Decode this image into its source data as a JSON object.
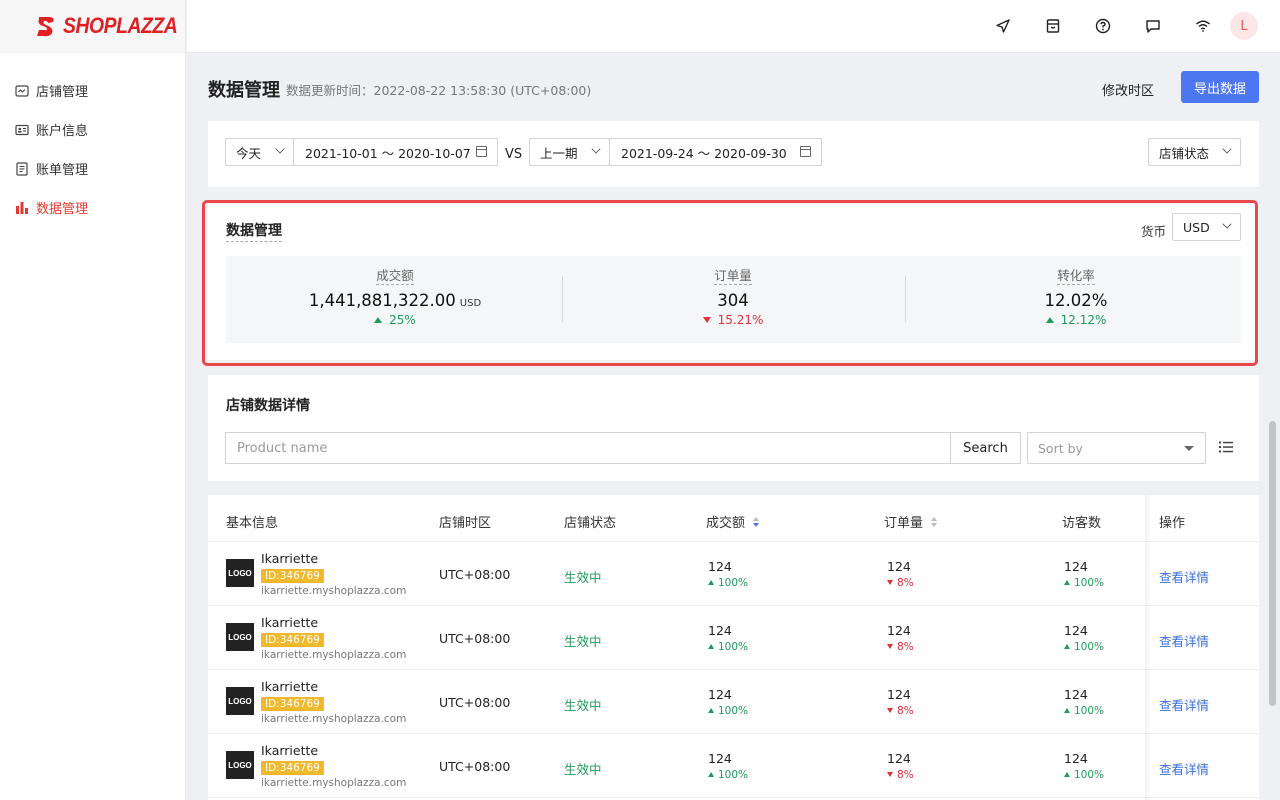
{
  "brand": {
    "name": "SHOPLAZZA",
    "color": "#e02020"
  },
  "sidebar": {
    "items": [
      {
        "label": "店铺管理",
        "icon": "store-icon",
        "active": false
      },
      {
        "label": "账户信息",
        "icon": "id-card-icon",
        "active": false
      },
      {
        "label": "账单管理",
        "icon": "bill-icon",
        "active": false
      },
      {
        "label": "数据管理",
        "icon": "bar-chart-icon",
        "active": true
      }
    ]
  },
  "topbar": {
    "icons": [
      "navigate-icon",
      "shop-icon",
      "help-icon",
      "message-icon",
      "wifi-icon"
    ],
    "avatar_initial": "L"
  },
  "header": {
    "title": "数据管理",
    "subtitle": "数据更新时间：2022-08-22 13:58:30 (UTC+08:00)",
    "tz_link": "修改时区",
    "export_label": "导出数据"
  },
  "filters": {
    "period_select": "今天",
    "date_range": "2021-10-01 ～ 2020-10-07",
    "vs_label": "VS",
    "compare_select": "上一期",
    "compare_range": "2021-09-24 ～ 2020-09-30",
    "status_select": "店铺状态"
  },
  "stats": {
    "title": "数据管理",
    "currency_label": "货币",
    "currency_value": "USD",
    "items": [
      {
        "label": "成交额",
        "value": "1,441,881,322.00",
        "unit": "USD",
        "delta": "25%",
        "direction": "up"
      },
      {
        "label": "订单量",
        "value": "304",
        "unit": "",
        "delta": "15.21%",
        "direction": "down"
      },
      {
        "label": "转化率",
        "value": "12.02%",
        "unit": "",
        "delta": "12.12%",
        "direction": "up"
      }
    ]
  },
  "search": {
    "title": "店铺数据详情",
    "placeholder": "Product name",
    "button": "Search",
    "sort_placeholder": "Sort by"
  },
  "table": {
    "columns": [
      "基本信息",
      "店铺时区",
      "店铺状态",
      "成交额",
      "订单量",
      "访客数",
      "操作"
    ],
    "rows": [
      {
        "logo": "LOGO",
        "name": "Ikarriette",
        "id": "ID:346769",
        "url": "ikarriette.myshoplazza.com",
        "tz": "UTC+08:00",
        "status": "生效中",
        "gmv": "124",
        "gmv_delta": "100%",
        "orders": "124",
        "orders_delta": "8%",
        "visitors": "124",
        "visitors_delta": "100%",
        "action": "查看详情"
      },
      {
        "logo": "LOGO",
        "name": "Ikarriette",
        "id": "ID:346769",
        "url": "ikarriette.myshoplazza.com",
        "tz": "UTC+08:00",
        "status": "生效中",
        "gmv": "124",
        "gmv_delta": "100%",
        "orders": "124",
        "orders_delta": "8%",
        "visitors": "124",
        "visitors_delta": "100%",
        "action": "查看详情"
      },
      {
        "logo": "LOGO",
        "name": "Ikarriette",
        "id": "ID:346769",
        "url": "ikarriette.myshoplazza.com",
        "tz": "UTC+08:00",
        "status": "生效中",
        "gmv": "124",
        "gmv_delta": "100%",
        "orders": "124",
        "orders_delta": "8%",
        "visitors": "124",
        "visitors_delta": "100%",
        "action": "查看详情"
      },
      {
        "logo": "LOGO",
        "name": "Ikarriette",
        "id": "ID:346769",
        "url": "ikarriette.myshoplazza.com",
        "tz": "UTC+08:00",
        "status": "生效中",
        "gmv": "124",
        "gmv_delta": "100%",
        "orders": "124",
        "orders_delta": "8%",
        "visitors": "124",
        "visitors_delta": "100%",
        "action": "查看详情"
      }
    ]
  },
  "colors": {
    "accent": "#4d77f0",
    "up": "#1e9a5b",
    "down": "#e0303a",
    "highlight": "#e8474b"
  }
}
